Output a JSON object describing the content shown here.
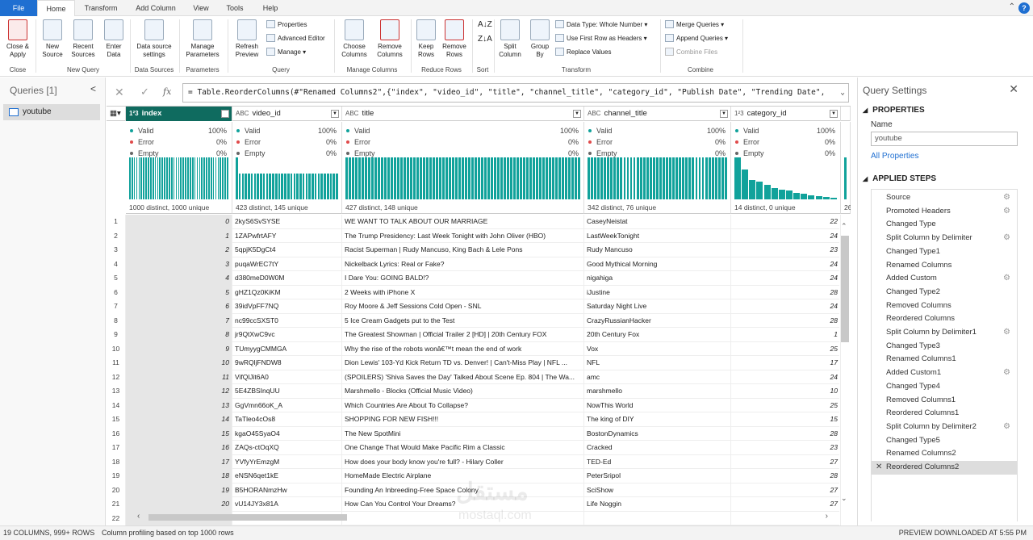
{
  "tabs": {
    "file": "File",
    "home": "Home",
    "transform": "Transform",
    "add_column": "Add Column",
    "view": "View",
    "tools": "Tools",
    "help": "Help",
    "help_icon": "?"
  },
  "ribbon": {
    "close_apply": "Close &\nApply",
    "new_source": "New\nSource",
    "recent_sources": "Recent\nSources",
    "enter_data": "Enter\nData",
    "data_source_settings": "Data source\nsettings",
    "manage_parameters": "Manage\nParameters",
    "refresh_preview": "Refresh\nPreview",
    "properties": "Properties",
    "advanced_editor": "Advanced Editor",
    "manage": "Manage",
    "choose_columns": "Choose\nColumns",
    "remove_columns": "Remove\nColumns",
    "keep_rows": "Keep\nRows",
    "remove_rows": "Remove\nRows",
    "split_column": "Split\nColumn",
    "group_by": "Group\nBy",
    "data_type": "Data Type: Whole Number",
    "first_row_headers": "Use First Row as Headers",
    "replace_values": "Replace Values",
    "merge_queries": "Merge Queries",
    "append_queries": "Append Queries",
    "combine_files": "Combine Files",
    "groups": {
      "close": "Close",
      "new_query": "New Query",
      "data_sources": "Data Sources",
      "parameters": "Parameters",
      "query": "Query",
      "manage_columns": "Manage Columns",
      "reduce_rows": "Reduce Rows",
      "sort": "Sort",
      "transform": "Transform",
      "combine": "Combine"
    }
  },
  "queries_panel": {
    "title": "Queries [1]",
    "collapse": "<",
    "items": [
      "youtube"
    ]
  },
  "formula": {
    "cancel": "✕",
    "commit": "✓",
    "fx": "fx",
    "text": "= Table.ReorderColumns(#\"Renamed Columns2\",{\"index\", \"video_id\", \"title\", \"channel_title\", \"category_id\", \"Publish Date\", \"Trending Date\","
  },
  "columns": [
    {
      "type": "1²3",
      "name": "index",
      "valid": "100%",
      "error": "0%",
      "empty": "0%",
      "stat": "1000 distinct, 1000 unique",
      "profile": [
        1,
        1,
        1,
        1,
        1,
        1,
        1,
        1,
        1,
        1,
        1,
        1,
        1,
        1,
        1,
        1,
        1,
        1,
        1,
        1,
        1,
        1,
        1,
        1,
        1,
        1,
        1,
        1,
        1,
        1,
        1,
        1,
        1,
        1,
        1,
        1,
        1,
        1,
        1,
        1,
        1,
        1,
        1
      ]
    },
    {
      "type": "ABC",
      "name": "video_id",
      "valid": "100%",
      "error": "0%",
      "empty": "0%",
      "stat": "423 distinct, 145 unique",
      "profile": [
        1,
        0.62,
        0.62,
        0.62,
        0.62,
        0.62,
        0.62,
        0.62,
        0.62,
        0.62,
        0.62,
        0.62,
        0.62,
        0.62,
        0.62,
        0.62,
        0.62,
        0.62,
        0.62,
        0.62,
        0.62,
        0.62,
        0.62,
        0.62,
        0.62,
        0.62,
        0.62,
        0.62,
        0.62,
        0.62,
        0.62,
        0.62,
        0.62,
        0.62
      ]
    },
    {
      "type": "ABC",
      "name": "title",
      "valid": "100%",
      "error": "0%",
      "empty": "0%",
      "stat": "427 distinct, 148 unique",
      "profile": [
        1,
        1,
        1,
        1,
        1,
        1,
        1,
        1,
        1,
        1,
        1,
        1,
        1,
        1,
        1,
        1,
        1,
        1,
        1,
        1,
        1,
        1,
        1,
        1,
        1,
        1,
        1,
        1,
        1,
        1,
        1,
        1,
        1,
        1,
        1,
        1,
        1,
        1,
        1,
        1,
        1,
        1,
        1,
        1,
        1,
        1,
        1,
        1,
        1,
        1,
        1,
        1,
        1,
        1,
        1,
        1,
        1,
        1,
        1,
        1,
        1,
        1,
        1,
        1,
        1,
        1,
        1,
        1,
        1,
        1,
        1,
        1,
        1
      ]
    },
    {
      "type": "ABC",
      "name": "channel_title",
      "valid": "100%",
      "error": "0%",
      "empty": "0%",
      "stat": "342 distinct, 76 unique",
      "profile": [
        1,
        1,
        1,
        1,
        1,
        1,
        1,
        1,
        1,
        1,
        1,
        1,
        1,
        1,
        1,
        1,
        1,
        1,
        1,
        1,
        1,
        1,
        1,
        1,
        1,
        1,
        1,
        1,
        1,
        1,
        1,
        1,
        1,
        1,
        1,
        1,
        1,
        1,
        1,
        1,
        1,
        1,
        1
      ]
    },
    {
      "type": "1²3",
      "name": "category_id",
      "valid": "100%",
      "error": "0%",
      "empty": "0%",
      "stat": "14 distinct, 0 unique",
      "profile": [
        1,
        0.72,
        0.46,
        0.42,
        0.34,
        0.26,
        0.24,
        0.22,
        0.16,
        0.14,
        0.1,
        0.08,
        0.06,
        0.04
      ]
    },
    {
      "type": "",
      "name": "",
      "valid": "",
      "error": "",
      "empty": "",
      "stat": "26",
      "profile": [
        1
      ]
    }
  ],
  "profile_labels": {
    "valid": "Valid",
    "error": "Error",
    "empty": "Empty"
  },
  "rows": [
    [
      "1",
      "0",
      "2kyS6SvSYSE",
      "WE WANT TO TALK ABOUT OUR MARRIAGE",
      "CaseyNeistat",
      "22"
    ],
    [
      "2",
      "1",
      "1ZAPwfrtAFY",
      "The Trump Presidency: Last Week Tonight with John Oliver (HBO)",
      "LastWeekTonight",
      "24"
    ],
    [
      "3",
      "2",
      "5qpjK5DgCt4",
      "Racist Superman | Rudy Mancuso, King Bach & Lele Pons",
      "Rudy Mancuso",
      "23"
    ],
    [
      "4",
      "3",
      "puqaWrEC7tY",
      "Nickelback Lyrics: Real or Fake?",
      "Good Mythical Morning",
      "24"
    ],
    [
      "5",
      "4",
      "d380meD0W0M",
      "I Dare You: GOING BALD!?",
      "nigahiga",
      "24"
    ],
    [
      "6",
      "5",
      "gHZ1Qz0KiKM",
      "2 Weeks with iPhone X",
      "iJustine",
      "28"
    ],
    [
      "7",
      "6",
      "39idVpFF7NQ",
      "Roy Moore & Jeff Sessions Cold Open - SNL",
      "Saturday Night Live",
      "24"
    ],
    [
      "8",
      "7",
      "nc99ccSXST0",
      "5 Ice Cream Gadgets put to the Test",
      "CrazyRussianHacker",
      "28"
    ],
    [
      "9",
      "8",
      "jr9QtXwC9vc",
      "The Greatest Showman | Official Trailer 2 [HD] | 20th Century FOX",
      "20th Century Fox",
      "1"
    ],
    [
      "10",
      "9",
      "TUmyygCMMGA",
      "Why the rise of the robots wonâ€™t mean the end of work",
      "Vox",
      "25"
    ],
    [
      "11",
      "10",
      "9wRQljFNDW8",
      "Dion Lewis' 103-Yd Kick Return TD vs. Denver! | Can't-Miss Play | NFL ...",
      "NFL",
      "17"
    ],
    [
      "12",
      "11",
      "VifQlJit6A0",
      "(SPOILERS) 'Shiva Saves the Day' Talked About Scene Ep. 804 | The Wa...",
      "amc",
      "24"
    ],
    [
      "13",
      "12",
      "5E4ZBSInqUU",
      "Marshmello - Blocks (Official Music Video)",
      "marshmello",
      "10"
    ],
    [
      "14",
      "13",
      "GgVmn66oK_A",
      "Which Countries Are About To Collapse?",
      "NowThis World",
      "25"
    ],
    [
      "15",
      "14",
      "TaTleo4cOs8",
      "SHOPPING FOR NEW FISH!!!",
      "The king of DIY",
      "15"
    ],
    [
      "16",
      "15",
      "kgaO45SyaO4",
      "The New SpotMini",
      "BostonDynamics",
      "28"
    ],
    [
      "17",
      "16",
      "ZAQs-ctOqXQ",
      "One Change That Would Make Pacific Rim a Classic",
      "Cracked",
      "23"
    ],
    [
      "18",
      "17",
      "YVfyYrEmzgM",
      "How does your body know you're full? - Hilary Coller",
      "TED-Ed",
      "27"
    ],
    [
      "19",
      "18",
      "eNSN6qet1kE",
      "HomeMade Electric Airplane",
      "PeterSripol",
      "28"
    ],
    [
      "20",
      "19",
      "B5HORANmzHw",
      "Founding An Inbreeding-Free Space Colony",
      "SciShow",
      "27"
    ],
    [
      "21",
      "20",
      "vU14JY3x81A",
      "How Can You Control Your Dreams?",
      "Life Noggin",
      "27"
    ],
    [
      "22",
      "",
      "",
      "",
      "",
      ""
    ]
  ],
  "query_settings": {
    "title": "Query Settings",
    "close": "✕",
    "properties": "PROPERTIES",
    "name_label": "Name",
    "name_value": "youtube",
    "all_properties": "All Properties",
    "applied_steps": "APPLIED STEPS",
    "steps": [
      {
        "name": "Source",
        "gear": true
      },
      {
        "name": "Promoted Headers",
        "gear": true
      },
      {
        "name": "Changed Type",
        "gear": false
      },
      {
        "name": "Split Column by Delimiter",
        "gear": true
      },
      {
        "name": "Changed Type1",
        "gear": false
      },
      {
        "name": "Renamed Columns",
        "gear": false
      },
      {
        "name": "Added Custom",
        "gear": true
      },
      {
        "name": "Changed Type2",
        "gear": false
      },
      {
        "name": "Removed Columns",
        "gear": false
      },
      {
        "name": "Reordered Columns",
        "gear": false
      },
      {
        "name": "Split Column by Delimiter1",
        "gear": true
      },
      {
        "name": "Changed Type3",
        "gear": false
      },
      {
        "name": "Renamed Columns1",
        "gear": false
      },
      {
        "name": "Added Custom1",
        "gear": true
      },
      {
        "name": "Changed Type4",
        "gear": false
      },
      {
        "name": "Removed Columns1",
        "gear": false
      },
      {
        "name": "Reordered Columns1",
        "gear": false
      },
      {
        "name": "Split Column by Delimiter2",
        "gear": true
      },
      {
        "name": "Changed Type5",
        "gear": false
      },
      {
        "name": "Renamed Columns2",
        "gear": false
      },
      {
        "name": "Reordered Columns2",
        "gear": false,
        "current": true
      }
    ]
  },
  "status": {
    "columns": "19 COLUMNS, 999+ ROWS",
    "profiling": "Column profiling based on top 1000 rows",
    "preview": "PREVIEW DOWNLOADED AT 5:55 PM"
  },
  "watermark": {
    "arabic": "مستقل",
    "latin": "mostaql.com"
  },
  "colors": {
    "accent": "#1f6fd1",
    "profile_bar": "#11a29b",
    "selected_header": "#0f6b5f",
    "valid": "#11a29b",
    "error": "#e04a4a",
    "empty": "#666666"
  }
}
